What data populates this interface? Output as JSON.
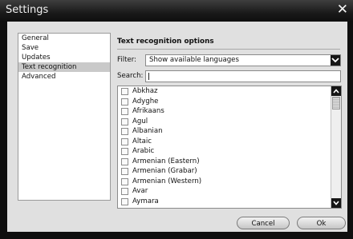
{
  "window": {
    "title": "Settings",
    "close_glyph": "✕"
  },
  "sidebar": {
    "items": [
      {
        "label": "General",
        "active": false
      },
      {
        "label": "Save",
        "active": false
      },
      {
        "label": "Updates",
        "active": false
      },
      {
        "label": "Text recognition",
        "active": true
      },
      {
        "label": "Advanced",
        "active": false
      }
    ]
  },
  "main": {
    "section_title": "Text recognition options",
    "filter": {
      "label": "Filter:",
      "value": "Show available languages"
    },
    "search": {
      "label": "Search:",
      "value": ""
    },
    "languages": [
      {
        "label": "Abkhaz",
        "checked": false
      },
      {
        "label": "Adyghe",
        "checked": false
      },
      {
        "label": "Afrikaans",
        "checked": false
      },
      {
        "label": "Agul",
        "checked": false
      },
      {
        "label": "Albanian",
        "checked": false
      },
      {
        "label": "Altaic",
        "checked": false
      },
      {
        "label": "Arabic",
        "checked": false
      },
      {
        "label": "Armenian (Eastern)",
        "checked": false
      },
      {
        "label": "Armenian (Grabar)",
        "checked": false
      },
      {
        "label": "Armenian (Western)",
        "checked": false
      },
      {
        "label": "Avar",
        "checked": false
      },
      {
        "label": "Aymara",
        "checked": false
      }
    ]
  },
  "buttons": {
    "cancel": "Cancel",
    "ok": "Ok"
  },
  "icons": {
    "dropdown": "chevron-down-icon",
    "scroll_up": "chevron-up-icon",
    "scroll_down": "chevron-down-icon",
    "close": "close-icon"
  },
  "colors": {
    "titlebar": "#1a1a1a",
    "dialog_bg": "#e0e0e0",
    "selected_item": "#c9c9c9"
  }
}
